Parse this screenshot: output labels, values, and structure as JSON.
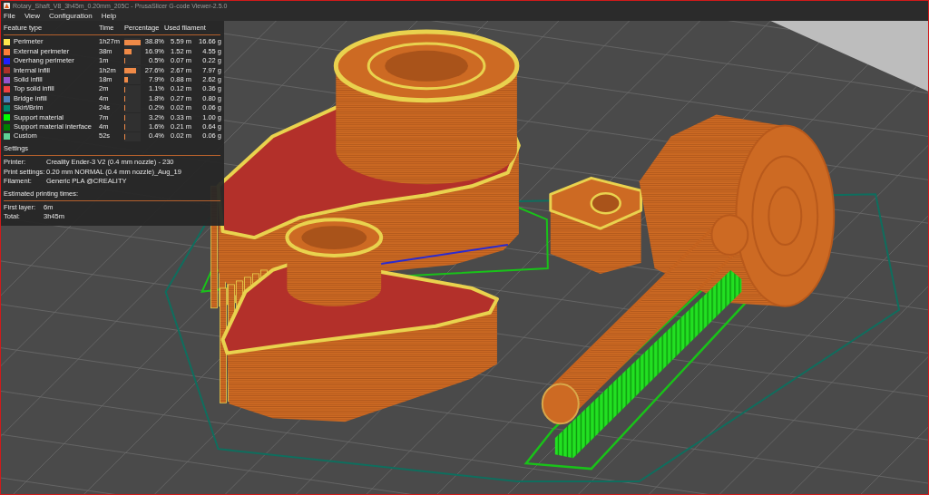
{
  "window": {
    "title": "Rotary_Shaft_V8_3h45m_0.20mm_205C - PrusaSlicer G-code Viewer-2.5.0"
  },
  "menu": [
    "File",
    "View",
    "Configuration",
    "Help"
  ],
  "legend": {
    "columns": [
      "Feature type",
      "Time",
      "Percentage",
      "Used filament"
    ],
    "features": [
      {
        "name": "Perimeter",
        "color": "#ffe64d",
        "time": "1h27m",
        "level": 1.0,
        "percentage": "38.8%",
        "length": "5.59 m",
        "weight": "16.66 g"
      },
      {
        "name": "External perimeter",
        "color": "#ff7d38",
        "time": "38m",
        "level": 0.436,
        "percentage": "16.9%",
        "length": "1.52 m",
        "weight": "4.55 g"
      },
      {
        "name": "Overhang perimeter",
        "color": "#1f1fff",
        "time": "1m",
        "level": 0.013,
        "percentage": "0.5%",
        "length": "0.07 m",
        "weight": "0.22 g"
      },
      {
        "name": "Internal infill",
        "color": "#b03029",
        "time": "1h2m",
        "level": 0.711,
        "percentage": "27.6%",
        "length": "2.67 m",
        "weight": "7.97 g"
      },
      {
        "name": "Solid infill",
        "color": "#9654cc",
        "time": "18m",
        "level": 0.204,
        "percentage": "7.9%",
        "length": "0.88 m",
        "weight": "2.62 g"
      },
      {
        "name": "Top solid infill",
        "color": "#f04040",
        "time": "2m",
        "level": 0.028,
        "percentage": "1.1%",
        "length": "0.12 m",
        "weight": "0.36 g"
      },
      {
        "name": "Bridge infill",
        "color": "#4d80ba",
        "time": "4m",
        "level": 0.046,
        "percentage": "1.8%",
        "length": "0.27 m",
        "weight": "0.80 g"
      },
      {
        "name": "Skirt/Brim",
        "color": "#00876e",
        "time": "24s",
        "level": 0.005,
        "percentage": "0.2%",
        "length": "0.02 m",
        "weight": "0.06 g"
      },
      {
        "name": "Support material",
        "color": "#00ff00",
        "time": "7m",
        "level": 0.082,
        "percentage": "3.2%",
        "length": "0.33 m",
        "weight": "1.00 g"
      },
      {
        "name": "Support material interface",
        "color": "#008000",
        "time": "4m",
        "level": 0.041,
        "percentage": "1.6%",
        "length": "0.21 m",
        "weight": "0.64 g"
      },
      {
        "name": "Custom",
        "color": "#5ed194",
        "time": "52s",
        "level": 0.01,
        "percentage": "0.4%",
        "length": "0.02 m",
        "weight": "0.06 g"
      }
    ],
    "settings": {
      "title": "Settings",
      "rows": [
        {
          "label": "Printer:",
          "value": "Creality Ender-3 V2 (0.4 mm nozzle) - 230"
        },
        {
          "label": "Print settings:",
          "value": "0.20 mm NORMAL (0.4 mm nozzle)_Aug_19"
        },
        {
          "label": "Filament:",
          "value": "Generic PLA @CREALITY"
        }
      ]
    },
    "times": {
      "title": "Estimated printing times:",
      "rows": [
        {
          "label": "First layer:",
          "value": "6m"
        },
        {
          "label": "Total:",
          "value": "3h45m"
        }
      ]
    }
  }
}
